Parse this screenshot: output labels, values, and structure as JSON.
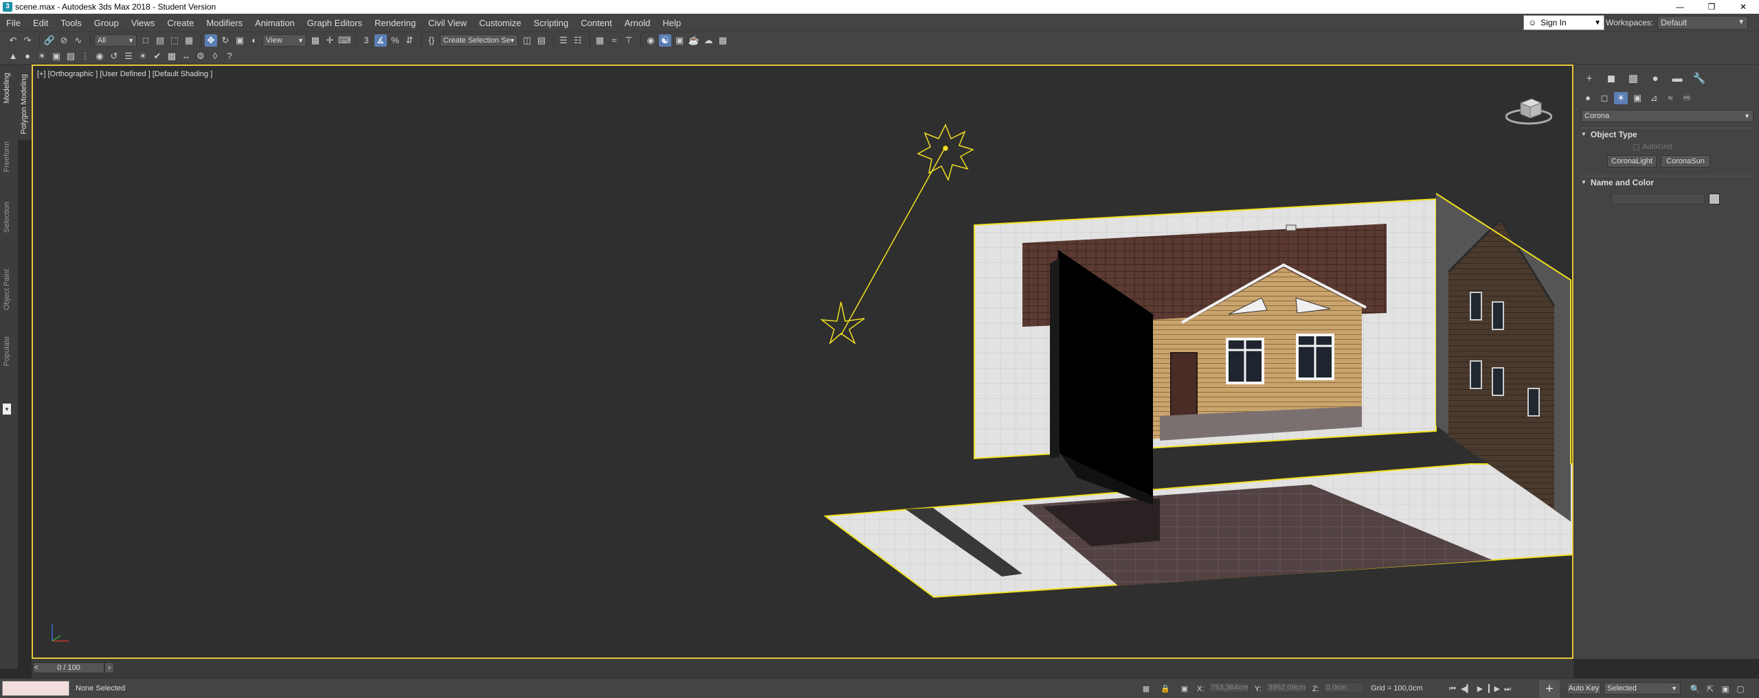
{
  "titlebar": {
    "title": "scene.max - Autodesk 3ds Max 2018 - Student Version",
    "app_icon": "3ds-max-icon",
    "minimize": "—",
    "restore": "❐",
    "close": "✕"
  },
  "menu": {
    "items": [
      "File",
      "Edit",
      "Tools",
      "Group",
      "Views",
      "Create",
      "Modifiers",
      "Animation",
      "Graph Editors",
      "Rendering",
      "Civil View",
      "Customize",
      "Scripting",
      "Content",
      "Arnold",
      "Help"
    ],
    "sign_in": "Sign In",
    "workspaces_label": "Workspaces:",
    "workspaces_value": "Default"
  },
  "toolbar": {
    "filter_value": "All",
    "reference_coord": "View",
    "named_selection": "Create Selection Se"
  },
  "ribbon_tabs": [
    "Modeling",
    "Freeform",
    "Selection",
    "Object Paint",
    "Populate"
  ],
  "ribbon_subtab": "Polygon Modeling",
  "viewport": {
    "label": "[+] [Orthographic ] [User Defined ] [Default Shading ]"
  },
  "command_panel": {
    "renderer_dropdown": "Corona",
    "object_type_title": "Object Type",
    "autogrid_label": "AutoGrid",
    "buttons": [
      "CoronaLight",
      "CoronaSun"
    ],
    "name_color_title": "Name and Color"
  },
  "time_slider": {
    "frame_display": "0 / 100",
    "prev": "<",
    "next": ">"
  },
  "status": {
    "selection": "None Selected",
    "x_label": "X:",
    "x_value": "753,364cm",
    "y_label": "Y:",
    "y_value": "3952,09cm",
    "z_label": "Z:",
    "z_value": "0,0cm",
    "grid": "Grid = 100,0cm",
    "auto_key": "Auto Key",
    "key_filter": "Selected"
  },
  "colors": {
    "viewport_border": "#e8c93a",
    "selection_yellow": "#f0e020",
    "background": "#2f2f2f"
  }
}
